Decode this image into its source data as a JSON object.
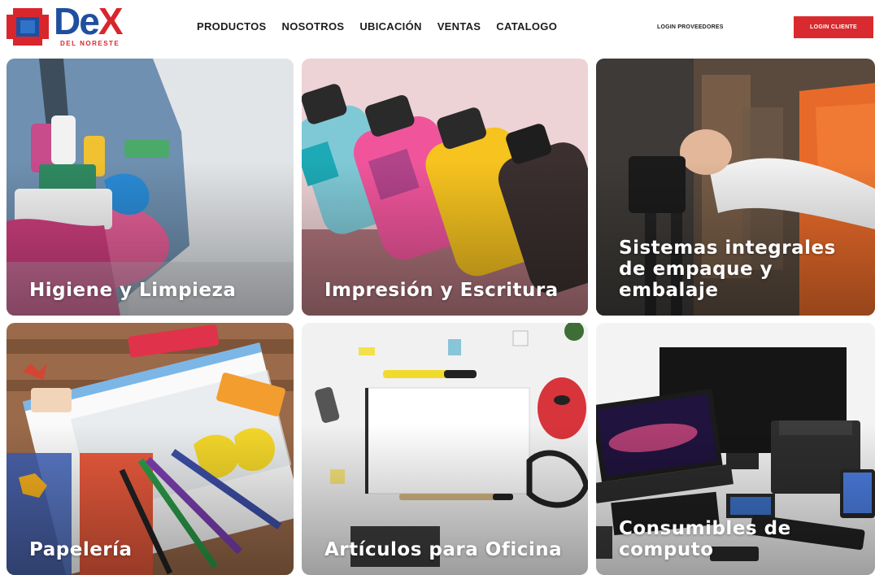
{
  "brand": {
    "name_part1": "De",
    "name_part2": "X",
    "tagline": "DEL NORESTE"
  },
  "nav": {
    "items": [
      "PRODUCTOS",
      "NOSOTROS",
      "UBICACIÓN",
      "VENTAS",
      "CATALOGO"
    ]
  },
  "header": {
    "login_providers": "LOGIN PROVEEDORES",
    "login_client": "LOGIN CLIENTE"
  },
  "categories": [
    {
      "title": "Higiene y Limpieza"
    },
    {
      "title": "Impresión y Escritura"
    },
    {
      "title": "Sistemas integrales de empaque y embalaje"
    },
    {
      "title": "Papelería"
    },
    {
      "title": "Artículos para Oficina"
    },
    {
      "title": "Consumibles de computo"
    }
  ],
  "colors": {
    "brand_red": "#d92b2f",
    "brand_blue": "#1f4f9e",
    "text_dark": "#1d1d1f"
  }
}
